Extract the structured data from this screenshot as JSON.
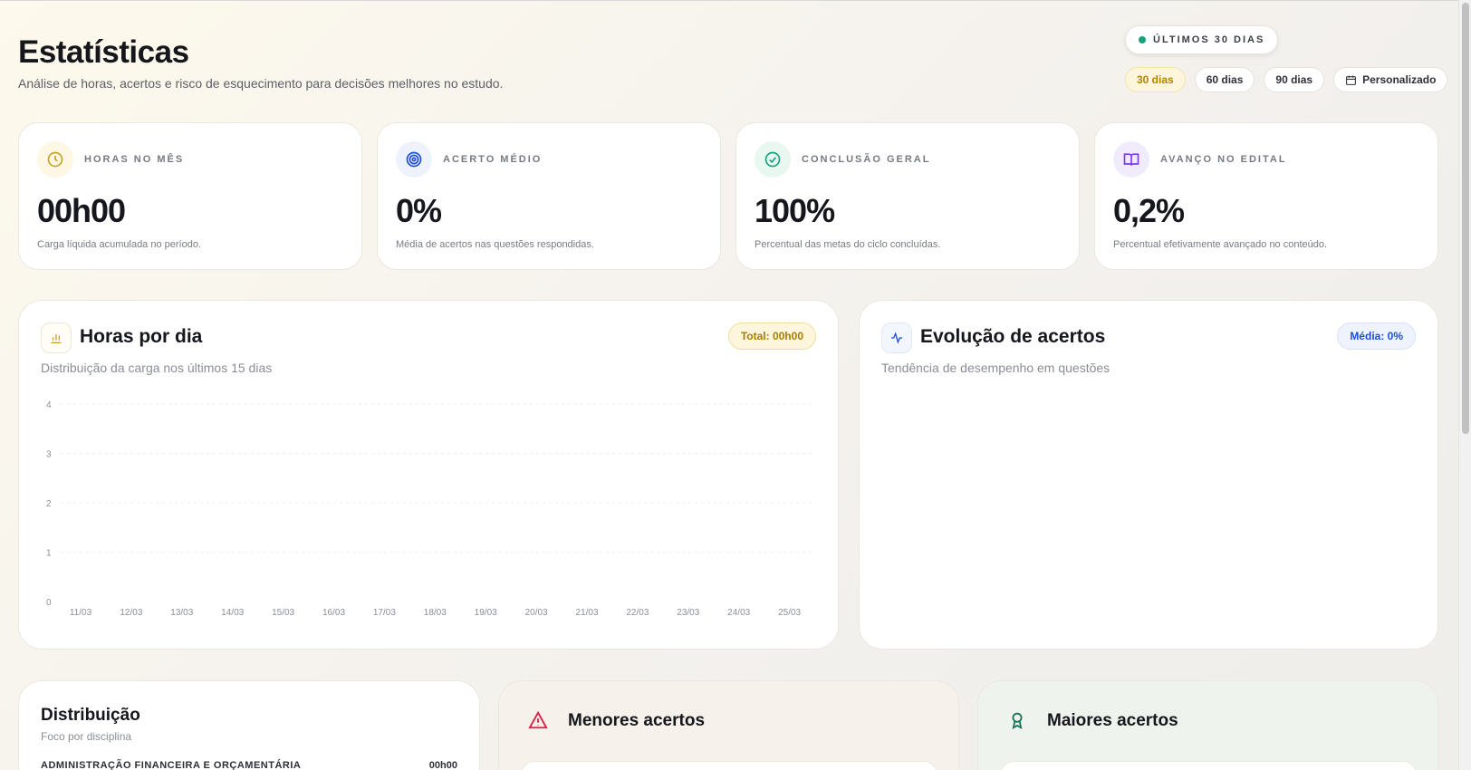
{
  "header": {
    "title": "Estatísticas",
    "subtitle": "Análise de horas, acertos e risco de esquecimento para decisões melhores no estudo."
  },
  "period": {
    "label": "ÚLTIMOS 30 DIAS",
    "ranges": [
      {
        "label": "30 dias",
        "active": true
      },
      {
        "label": "60 dias",
        "active": false
      },
      {
        "label": "90 dias",
        "active": false
      },
      {
        "label": "Personalizado",
        "active": false
      }
    ]
  },
  "kpis": [
    {
      "label": "HORAS NO MÊS",
      "value": "00h00",
      "desc": "Carga líquida acumulada no período.",
      "icon": "clock-icon",
      "color": "#c9a227",
      "bg": "#fdf7e4"
    },
    {
      "label": "ACERTO MÉDIO",
      "value": "0%",
      "desc": "Média de acertos nas questões respondidas.",
      "icon": "target-icon",
      "color": "#1d4ed8",
      "bg": "#edf2fd"
    },
    {
      "label": "CONCLUSÃO GERAL",
      "value": "100%",
      "desc": "Percentual das metas do ciclo concluídas.",
      "icon": "check-circle-icon",
      "color": "#16a37b",
      "bg": "#e9f7f1"
    },
    {
      "label": "AVANÇO NO EDITAL",
      "value": "0,2%",
      "desc": "Percentual efetivamente avançado no conteúdo.",
      "icon": "book-open-icon",
      "color": "#7c3aed",
      "bg": "#f1ecfd"
    }
  ],
  "hours_panel": {
    "title": "Horas por dia",
    "subtitle": "Distribuição da carga nos últimos 15 dias",
    "badge": "Total: 00h00",
    "icon": "bar-chart-icon"
  },
  "accuracy_panel": {
    "title": "Evolução de acertos",
    "subtitle": "Tendência de desempenho em questões",
    "badge": "Média: 0%",
    "icon": "activity-icon"
  },
  "chart_data": {
    "type": "bar",
    "categories": [
      "11/03",
      "12/03",
      "13/03",
      "14/03",
      "15/03",
      "16/03",
      "17/03",
      "18/03",
      "19/03",
      "20/03",
      "21/03",
      "22/03",
      "23/03",
      "24/03",
      "25/03"
    ],
    "values": [
      0,
      0,
      0,
      0,
      0,
      0,
      0,
      0,
      0,
      0,
      0,
      0,
      0,
      0,
      0
    ],
    "yticks": [
      "0",
      "1",
      "2",
      "3",
      "4"
    ],
    "ylim": [
      0,
      4
    ],
    "grid": true
  },
  "bottom": {
    "distribution": {
      "title": "Distribuição",
      "subtitle": "Foco por disciplina",
      "first_row_label": "ADMINISTRAÇÃO FINANCEIRA E ORÇAMENTÁRIA",
      "first_row_value": "00h00"
    },
    "lowest": {
      "title": "Menores acertos",
      "icon": "alert-triangle-icon"
    },
    "highest": {
      "title": "Maiores acertos",
      "icon": "award-icon"
    }
  },
  "colors": {
    "accent_gold": "#c9a227",
    "accent_blue": "#1d4ed8",
    "accent_green": "#16a37b",
    "accent_red": "#e11d48"
  }
}
